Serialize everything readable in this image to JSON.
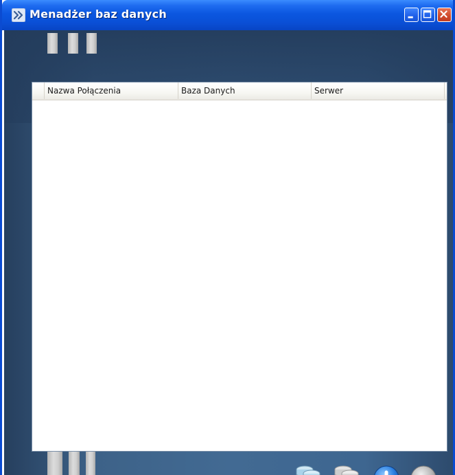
{
  "window": {
    "title": "Menadżer baz danych",
    "icons": {
      "app": "double-chevron-right-icon",
      "minimize": "minimize-icon",
      "maximize": "maximize-icon",
      "close": "close-icon"
    }
  },
  "list": {
    "columns": [
      "Nazwa Połączenia",
      "Baza Danych",
      "Serwer"
    ],
    "rows": []
  },
  "actions": [
    {
      "name": "add-database-button",
      "icon": "database-add-icon",
      "enabled": true
    },
    {
      "name": "remove-database-button",
      "icon": "database-remove-icon",
      "enabled": false
    },
    {
      "name": "add-button",
      "icon": "plus-circle-icon",
      "enabled": true
    },
    {
      "name": "remove-button",
      "icon": "minus-circle-icon",
      "enabled": false
    }
  ],
  "colors": {
    "titlebar": "#0a4fd6",
    "background": "#426a93",
    "list_background": "#ffffff"
  }
}
